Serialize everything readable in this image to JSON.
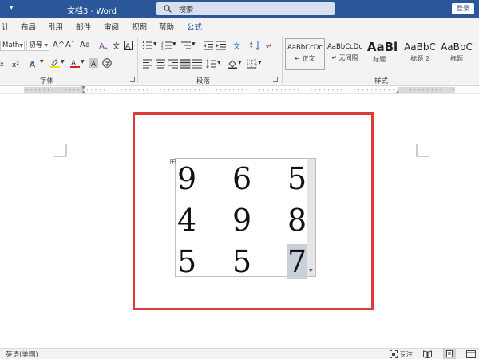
{
  "window": {
    "title": "文档3  -  Word",
    "search_placeholder": "搜索",
    "login_label": "登录"
  },
  "tabs": [
    {
      "label": "计",
      "active": false
    },
    {
      "label": "布局",
      "active": false
    },
    {
      "label": "引用",
      "active": false
    },
    {
      "label": "邮件",
      "active": false
    },
    {
      "label": "审阅",
      "active": false
    },
    {
      "label": "视图",
      "active": false
    },
    {
      "label": "帮助",
      "active": false
    },
    {
      "label": "公式",
      "active": true
    }
  ],
  "ribbon": {
    "font": {
      "name": "Math",
      "size": "初号",
      "grow_label": "A^",
      "shrink_label": "A˅",
      "case_label": "Aa",
      "group_label": "字体"
    },
    "paragraph": {
      "group_label": "段落"
    },
    "styles": {
      "group_label": "样式",
      "items": [
        {
          "sample": "AaBbCcDc",
          "name": "↵ 正文",
          "active": true
        },
        {
          "sample": "AaBbCcDc",
          "name": "↵ 无间隔",
          "active": false
        },
        {
          "sample": "AaBl",
          "name": "标题 1",
          "active": false
        },
        {
          "sample": "AaBbC",
          "name": "标题 2",
          "active": false
        },
        {
          "sample": "AaBbC",
          "name": "标题",
          "active": false
        }
      ]
    }
  },
  "document": {
    "table": [
      [
        "9",
        "6",
        "5"
      ],
      [
        "4",
        "9",
        "8"
      ],
      [
        "5",
        "5",
        "7"
      ]
    ],
    "selected_cell": [
      2,
      2
    ]
  },
  "statusbar": {
    "language": "英语(美国)",
    "focus_label": "专注"
  },
  "colors": {
    "titlebar": "#2b579a",
    "highlight_frame": "#e03b3b",
    "highlight_yellow": "#f5e000",
    "font_color_red": "#d42020"
  }
}
